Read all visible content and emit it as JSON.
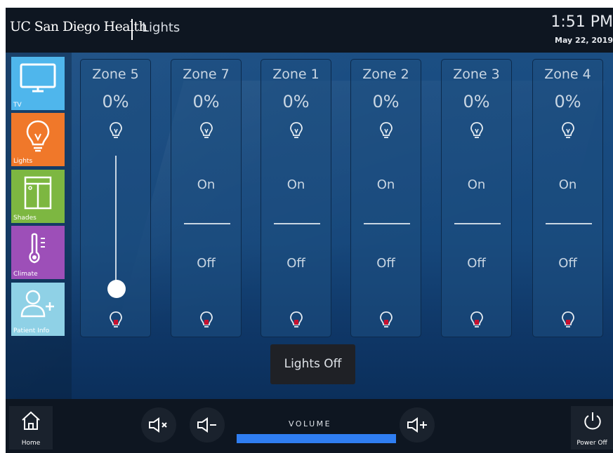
{
  "header": {
    "brand": "UC San Diego Health",
    "page_title": "Lights",
    "time": "1:51 PM",
    "date": "May 22, 2019"
  },
  "sidebar": {
    "items": [
      {
        "label": "TV",
        "icon": "tv-icon",
        "color": "#4fb6ec"
      },
      {
        "label": "Lights",
        "icon": "lightbulb-icon",
        "color": "#f0782a"
      },
      {
        "label": "Shades",
        "icon": "shades-icon",
        "color": "#7db741"
      },
      {
        "label": "Climate",
        "icon": "thermometer-icon",
        "color": "#9d4fb8"
      },
      {
        "label": "Patient Info",
        "icon": "add-user-icon",
        "color": "#8fd1e6"
      }
    ]
  },
  "zones": [
    {
      "name": "Zone 5",
      "level": "0%",
      "type": "dimmer",
      "slider_value": 0
    },
    {
      "name": "Zone 7",
      "level": "0%",
      "type": "switch",
      "on_label": "On",
      "off_label": "Off"
    },
    {
      "name": "Zone 1",
      "level": "0%",
      "type": "switch",
      "on_label": "On",
      "off_label": "Off"
    },
    {
      "name": "Zone 2",
      "level": "0%",
      "type": "switch",
      "on_label": "On",
      "off_label": "Off"
    },
    {
      "name": "Zone 3",
      "level": "0%",
      "type": "switch",
      "on_label": "On",
      "off_label": "Off"
    },
    {
      "name": "Zone 4",
      "level": "0%",
      "type": "switch",
      "on_label": "On",
      "off_label": "Off"
    }
  ],
  "lights_off_label": "Lights Off",
  "footer": {
    "home_label": "Home",
    "volume_label": "VOLUME",
    "volume_level": 1.0,
    "power_label": "Power Off",
    "volume_color": "#2f7ef2"
  }
}
